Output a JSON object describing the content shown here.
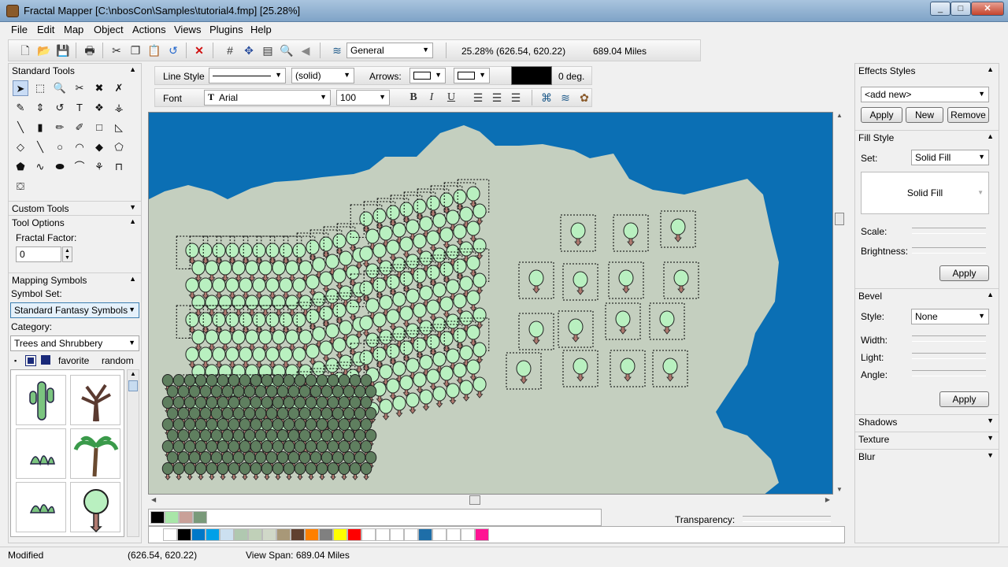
{
  "window": {
    "title": "Fractal Mapper [C:\\nbosCon\\Samples\\tutorial4.fmp] [25.28%]",
    "min": "_",
    "max": "□",
    "close": "✕"
  },
  "menu": [
    "File",
    "Edit",
    "Map",
    "Object",
    "Actions",
    "Views",
    "Plugins",
    "Help"
  ],
  "toolbar": {
    "layer": "General",
    "zoom_readout": "25.28%  (626.54, 620.22)",
    "distance": "689.04 Miles"
  },
  "linestyle": {
    "label": "Line Style",
    "style": "(solid)",
    "arrows_label": "Arrows:",
    "angle": "0 deg."
  },
  "font": {
    "label": "Font",
    "family": "Arial",
    "size": "100",
    "bold": "B",
    "italic": "I",
    "underline": "U"
  },
  "left": {
    "standard_tools": "Standard Tools",
    "custom_tools": "Custom Tools",
    "tool_options": "Tool Options",
    "fractal_factor_label": "Fractal Factor:",
    "fractal_factor": "0",
    "mapping_symbols": "Mapping Symbols",
    "symbol_set_label": "Symbol Set:",
    "symbol_set": "Standard Fantasy Symbols",
    "category_label": "Category:",
    "category": "Trees and Shrubbery",
    "favorite": "favorite",
    "random": "random"
  },
  "right": {
    "effects_styles": "Effects Styles",
    "add_new": "<add new>",
    "apply": "Apply",
    "new": "New",
    "remove": "Remove",
    "fill_style": "Fill Style",
    "set_label": "Set:",
    "set_value": "Solid Fill",
    "preview": "Solid Fill",
    "scale": "Scale:",
    "brightness": "Brightness:",
    "bevel": "Bevel",
    "style_label": "Style:",
    "style_value": "None",
    "width": "Width:",
    "light": "Light:",
    "angle": "Angle:",
    "shadows": "Shadows",
    "texture": "Texture",
    "blur": "Blur"
  },
  "bottom": {
    "transparency": "Transparency:"
  },
  "status": {
    "state": "Modified",
    "coords": "(626.54, 620.22)",
    "view_span": "View Span: 689.04 Miles"
  },
  "colors": {
    "sea": "#0b6fb4",
    "land": "#c4cfbf",
    "tree_light": "#b9f0c0",
    "tree_dark": "#5f7f5f",
    "trunk": "#b07a70"
  },
  "palette_top": [
    "#000000",
    "#a8e6a8",
    "#c9a098",
    "#7a9a7a"
  ],
  "palette_bottom": [
    "#ffffff",
    "#000000",
    "#0078c8",
    "#00a0e8",
    "#cce0f0",
    "#b0c8b0",
    "#c0d0b8",
    "#d0d8c8",
    "#a89878",
    "#604030",
    "#ff8000",
    "#808080",
    "#ffff00",
    "#ff0000",
    "#ffffff",
    "#ffffff",
    "#ffffff",
    "#ffffff",
    "#1e6ea8",
    "#ffffff",
    "#ffffff",
    "#ffffff",
    "#ff1493"
  ]
}
